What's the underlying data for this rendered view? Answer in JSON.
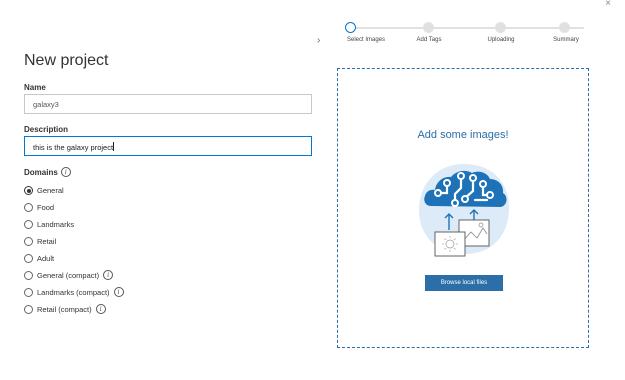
{
  "window": {
    "close_glyph": "×"
  },
  "stepper": {
    "steps": [
      {
        "label": "Select Images",
        "active": true
      },
      {
        "label": "Add Tags",
        "active": false
      },
      {
        "label": "Uploading",
        "active": false
      },
      {
        "label": "Summary",
        "active": false
      }
    ]
  },
  "form": {
    "title": "New project",
    "name_label": "Name",
    "name_value": "galaxy3",
    "description_label": "Description",
    "description_value": "this is the galaxy project",
    "domains_label": "Domains",
    "domains": [
      {
        "label": "General",
        "checked": true,
        "info": false
      },
      {
        "label": "Food",
        "checked": false,
        "info": false
      },
      {
        "label": "Landmarks",
        "checked": false,
        "info": false
      },
      {
        "label": "Retail",
        "checked": false,
        "info": false
      },
      {
        "label": "Adult",
        "checked": false,
        "info": false
      },
      {
        "label": "General (compact)",
        "checked": false,
        "info": true
      },
      {
        "label": "Landmarks (compact)",
        "checked": false,
        "info": true
      },
      {
        "label": "Retail (compact)",
        "checked": false,
        "info": true
      }
    ]
  },
  "upload": {
    "heading": "Add some images!",
    "browse_label": "Browse local files",
    "illustration_icon": "cloud-brain-upload-icon"
  },
  "colors": {
    "accent": "#0078d4",
    "brand_blue": "#2b6ea8",
    "cloud_blue": "#1e73b8"
  }
}
